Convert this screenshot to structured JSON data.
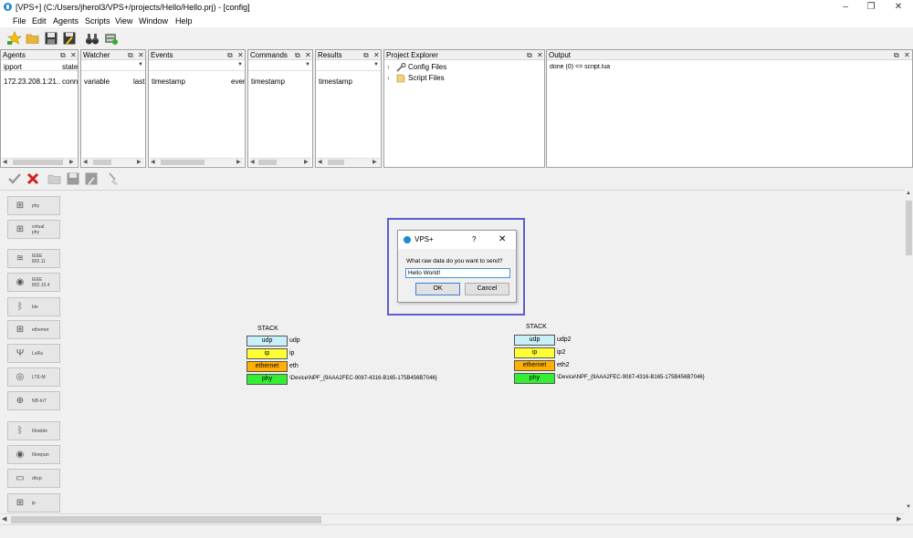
{
  "window": {
    "title": "[VPS+] (C:/Users/jherol3/VPS+/projects/Hello/Hello.prj) - [config]",
    "minimize": "–",
    "maximize": "❐",
    "close": "✕"
  },
  "menu": [
    "File",
    "Edit",
    "Agents",
    "Scripts",
    "View",
    "Window",
    "Help"
  ],
  "panels": {
    "agents": {
      "title": "Agents",
      "col1": "ipport",
      "col2": "state",
      "row1_col1": "172.23.208.1:21...",
      "row1_col2": "conn"
    },
    "watcher": {
      "title": "Watcher",
      "col1": "variable",
      "col2": "last"
    },
    "events": {
      "title": "Events",
      "col1": "timestamp",
      "col2": "ever"
    },
    "commands": {
      "title": "Commands",
      "col1": "timestamp"
    },
    "results": {
      "title": "Results",
      "col1": "timestamp"
    },
    "project": {
      "title": "Project Explorer",
      "items": [
        "Config Files",
        "Script Files"
      ]
    },
    "output": {
      "title": "Output",
      "line1": "done (0) <= script.lua"
    },
    "ctl_float": "⧉",
    "ctl_close": "✕"
  },
  "sidebar": [
    {
      "label": "phy",
      "icon": "network-icon",
      "glyph": "⊞"
    },
    {
      "label": "virtual\nphy",
      "icon": "network-icon",
      "glyph": "⊞"
    },
    {
      "label": "IEEE\n802.11",
      "icon": "wifi-icon",
      "glyph": "≋"
    },
    {
      "label": "IEEE\n802.15.4",
      "icon": "radio-waves-icon",
      "glyph": "◉"
    },
    {
      "label": "ble",
      "icon": "bluetooth-icon",
      "glyph": "ᛒ"
    },
    {
      "label": "ethernet",
      "icon": "network-icon",
      "glyph": "⊞"
    },
    {
      "label": "LoRa",
      "icon": "antenna-icon",
      "glyph": "Ψ"
    },
    {
      "label": "LTE-M",
      "icon": "cellular-icon",
      "glyph": "◎"
    },
    {
      "label": "NB-IoT",
      "icon": "globe-icon",
      "glyph": "⊕"
    },
    {
      "label": "6lowble",
      "icon": "bluetooth-icon",
      "glyph": "ᛒ"
    },
    {
      "label": "6lowpan",
      "icon": "radio-waves-icon",
      "glyph": "◉"
    },
    {
      "label": "dhcp",
      "icon": "computer-icon",
      "glyph": "▭"
    },
    {
      "label": "ip",
      "icon": "network-icon",
      "glyph": "⊞"
    }
  ],
  "stacks": [
    {
      "title": "STACK",
      "layers": [
        {
          "name": "udp",
          "label": "udp",
          "color": "#c8f0f8"
        },
        {
          "name": "ip",
          "label": "ip",
          "color": "#ffff33"
        },
        {
          "name": "ethernet",
          "label": "eth",
          "color": "#ffb000"
        },
        {
          "name": "phy",
          "label": "\\Device\\NPF_{9AAA2FEC-9087-4316-B165-175B456B7046}",
          "color": "#33ee33"
        }
      ]
    },
    {
      "title": "STACK",
      "layers": [
        {
          "name": "udp",
          "label": "udp2",
          "color": "#c8f0f8"
        },
        {
          "name": "ip",
          "label": "ip2",
          "color": "#ffff33"
        },
        {
          "name": "ethernet",
          "label": "eth2",
          "color": "#ffb000"
        },
        {
          "name": "phy",
          "label": "\\Device\\NPF_{9AAA2FEC-9087-4316-B165-175B456B7046}",
          "color": "#33ee33"
        }
      ]
    }
  ],
  "dialog": {
    "title": "VPS+",
    "help": "?",
    "close": "✕",
    "prompt": "What raw data do you want to send?",
    "input_value": "Hello World!",
    "ok": "OK",
    "cancel": "Cancel"
  }
}
